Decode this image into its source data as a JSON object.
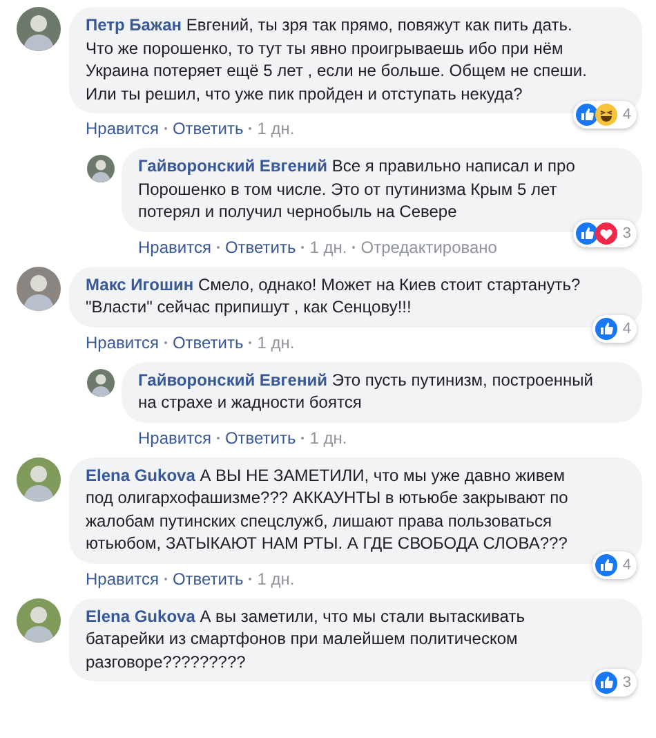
{
  "comments": [
    {
      "author": "Петр Бажан",
      "lines": [
        "Евгений, ты зря так прямо, повяжут как пить дать.",
        "Что же порошенко, то тут ты явно проигрываешь ибо при нём",
        "Украина потеряет ещё 5 лет , если не больше. Общем не спеши.",
        "Или ты решил, что уже пик пройден и отступать некуда?"
      ],
      "reactions": {
        "icons": [
          {
            "kind": "like"
          },
          {
            "kind": "haha"
          }
        ],
        "count": "4"
      },
      "actions": [
        "Нравится",
        "Ответить",
        "1 дн."
      ],
      "children": [
        {
          "author": "Гайворонский Евгений",
          "lines": [
            "Все я правильно написал и про",
            "Порошенко в том числе. Это от путинизма Крым 5 лет",
            "потерял и получил чернобыль на Севере"
          ],
          "reactions": {
            "icons": [
              {
                "kind": "like"
              },
              {
                "kind": "love"
              }
            ],
            "count": "3"
          },
          "actions": [
            "Нравится",
            "Ответить",
            "1 дн.",
            "Отредактировано"
          ]
        }
      ]
    },
    {
      "author": "Макс Игошин",
      "lines": [
        "Смело, однако! Может на Киев стоит стартануть?",
        "\"Власти\" сейчас припишут , как Сенцову!!!"
      ],
      "reactions": {
        "icons": [
          {
            "kind": "like"
          }
        ],
        "count": "4"
      },
      "actions": [
        "Нравится",
        "Ответить",
        "1 дн."
      ],
      "children": [
        {
          "author": "Гайворонский Евгений",
          "lines": [
            "Это пусть путинизм, построенный",
            "на страхе и жадности боятся"
          ],
          "actions": [
            "Нравится",
            "Ответить",
            "1 дн."
          ]
        }
      ]
    },
    {
      "author": "Elena Gukova",
      "lines": [
        "А ВЫ НЕ ЗАМЕТИЛИ, что мы уже давно живем",
        "под олигархофашизме??? АККАУНТЫ в ютьюбе закрывают по",
        "жалобам путинских спецслужб, лишают права пользоваться",
        "ютьюбом, ЗАТЫКАЮТ НАМ РТЫ. А ГДЕ СВОБОДА СЛОВА???"
      ],
      "reactions": {
        "icons": [
          {
            "kind": "like"
          }
        ],
        "count": "4"
      },
      "actions": [
        "Нравится",
        "Ответить",
        "1 дн."
      ]
    },
    {
      "author": "Elena Gukova",
      "lines": [
        "А вы заметили, что мы стали вытаскивать",
        "батарейки из смартфонов при малейшем политическом",
        "разговоре?????????"
      ],
      "reactions": {
        "icons": [
          {
            "kind": "like"
          }
        ],
        "count": "3"
      }
    }
  ]
}
